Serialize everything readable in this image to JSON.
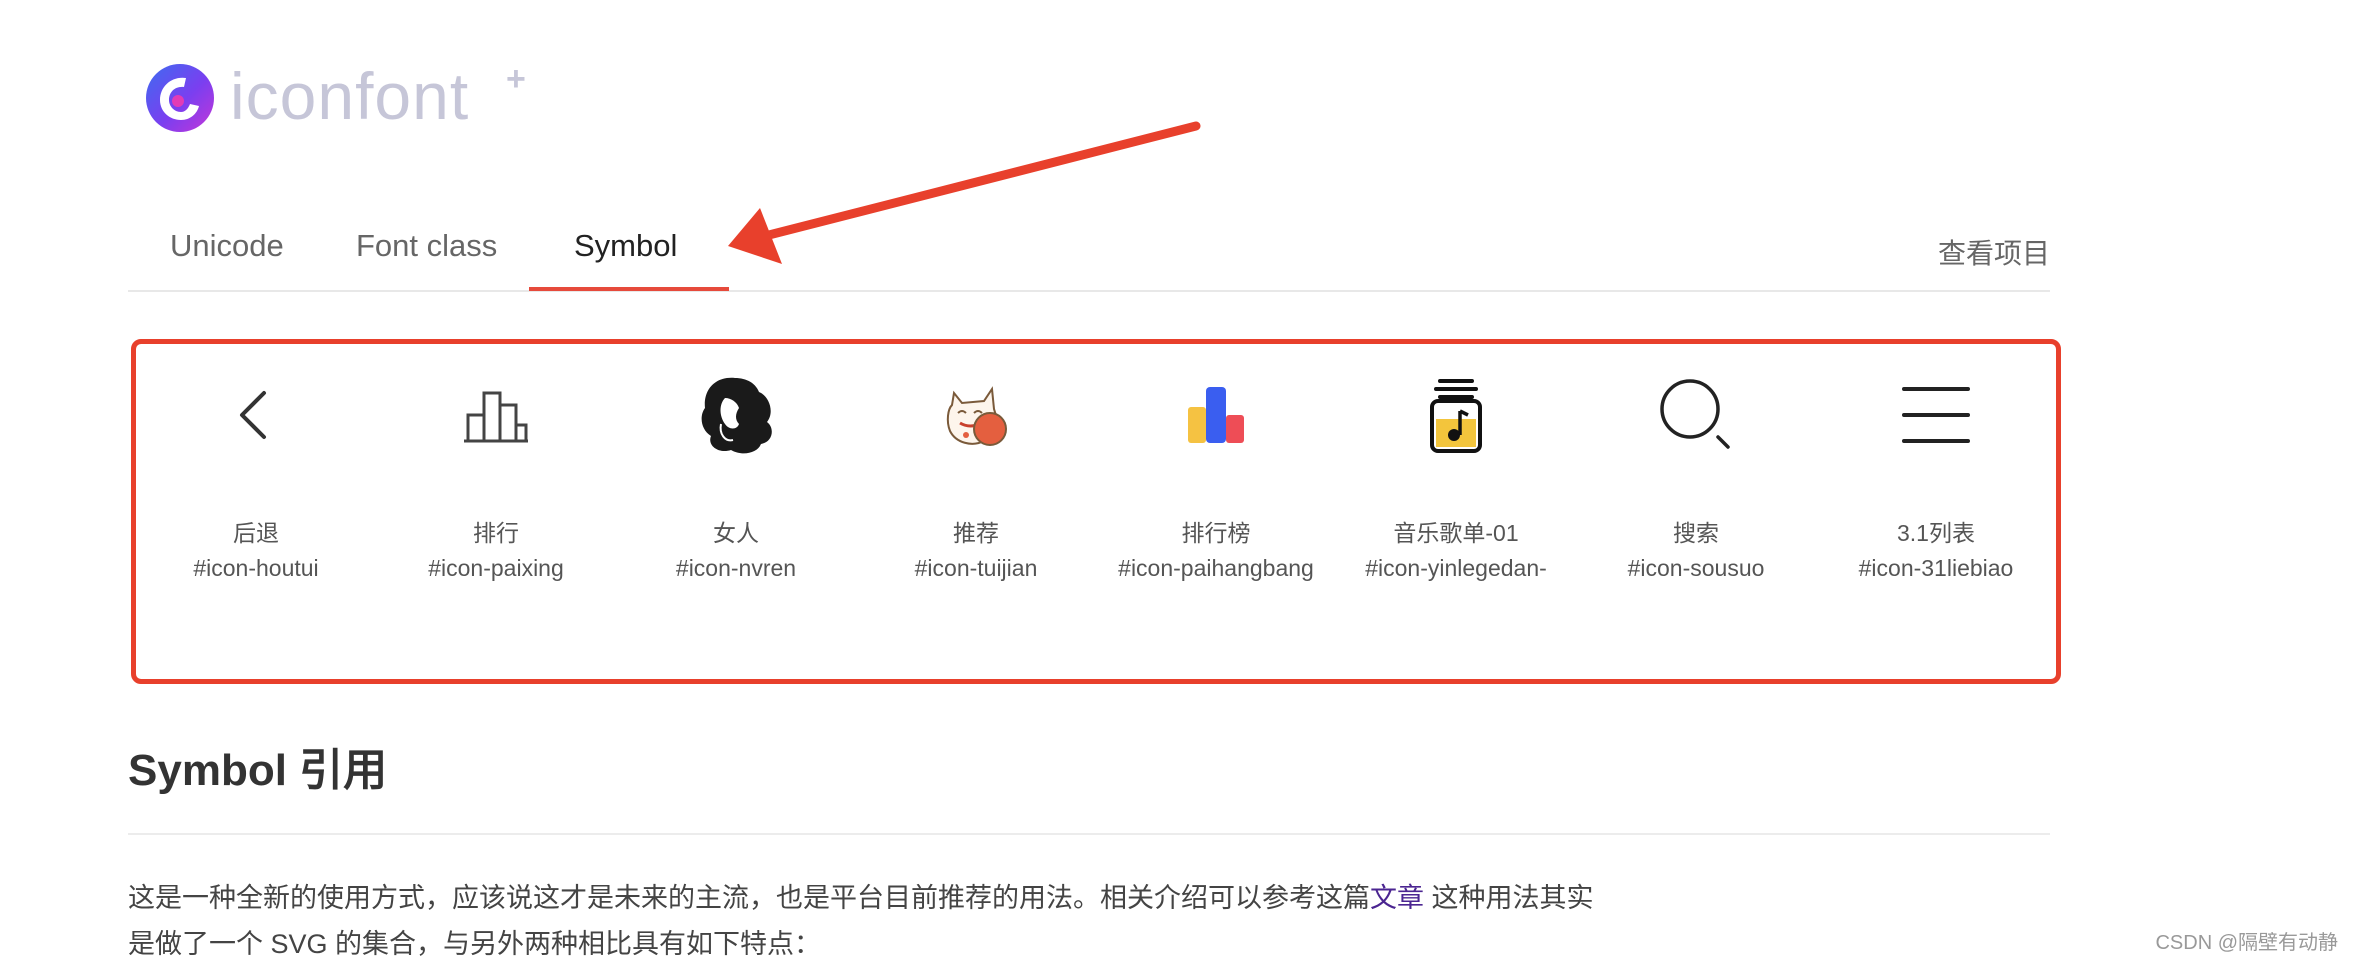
{
  "logo": {
    "text": "iconfont",
    "plus": "+"
  },
  "tabs": [
    {
      "label": "Unicode"
    },
    {
      "label": "Font class"
    },
    {
      "label": "Symbol"
    }
  ],
  "header": {
    "view_project": "查看项目"
  },
  "icons": [
    {
      "name": "后退",
      "code": "#icon-houtui",
      "icon": "chevron-left"
    },
    {
      "name": "排行",
      "code": "#icon-paixing",
      "icon": "podium"
    },
    {
      "name": "女人",
      "code": "#icon-nvren",
      "icon": "woman"
    },
    {
      "name": "推荐",
      "code": "#icon-tuijian",
      "icon": "lucky-cat"
    },
    {
      "name": "排行榜",
      "code": "#icon-paihangbang",
      "icon": "bar-chart"
    },
    {
      "name": "音乐歌单-01",
      "code": "#icon-yinlegedan-",
      "icon": "music-jar"
    },
    {
      "name": "搜索",
      "code": "#icon-sousuo",
      "icon": "search"
    },
    {
      "name": "3.1列表",
      "code": "#icon-31liebiao",
      "icon": "list"
    }
  ],
  "section": {
    "title": "Symbol 引用",
    "para1_before": "这是一种全新的使用方式，应该说这才是未来的主流，也是平台目前推荐的用法。相关介绍可以参考这篇",
    "para1_link": "文章",
    "para1_after": " 这种用法其实",
    "para2": "是做了一个 SVG 的集合，与另外两种相比具有如下特点："
  },
  "watermark": "CSDN @隔壁有动静",
  "colors": {
    "accent": "#e64a3b",
    "highlight_border": "#e8402c",
    "link": "#4b2591"
  }
}
